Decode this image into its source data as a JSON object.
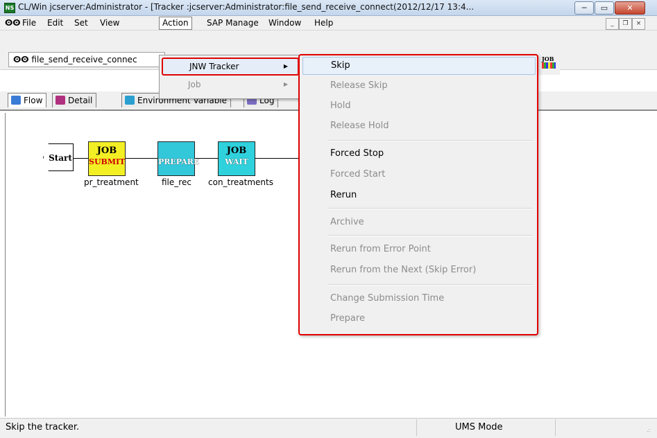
{
  "window": {
    "app_icon_text": "NS",
    "title": "CL/Win jcserver:Administrator - [Tracker :jcserver:Administrator:file_send_receive_connect(2012/12/17 13:4...",
    "controls": {
      "minimize": "─",
      "maximize": "▭",
      "close": "✕"
    }
  },
  "menubar": {
    "doc_icon": "ⵙⵙ",
    "items": [
      "File",
      "Edit",
      "Set",
      "View",
      "Action",
      "SAP Manage",
      "Window",
      "Help"
    ],
    "mdi_controls": {
      "minimize": "_",
      "restore": "❐",
      "close": "×"
    }
  },
  "toolbar": {
    "jobnet_name": "file_send_receive_connec",
    "logo_text": "JOB"
  },
  "tabs": [
    {
      "label": "Flow",
      "icon": "flow-icon",
      "color": "#3a7bd5"
    },
    {
      "label": "Detail",
      "icon": "detail-icon",
      "color": "#b03080"
    },
    {
      "label": "Environment Variable",
      "icon": "environment-icon",
      "color": "#2a9fd0"
    },
    {
      "label": "Log",
      "icon": "log-icon",
      "color": "#7a6cc0"
    }
  ],
  "flow": {
    "nodes": [
      {
        "id": "start",
        "text": "Start"
      },
      {
        "id": "submit",
        "line1": "JOB",
        "line2": "SUBMIT",
        "label": "pr_treatment"
      },
      {
        "id": "prepare",
        "line1": "",
        "line2": "PREPARE",
        "label": "file_rec"
      },
      {
        "id": "wait",
        "line1": "JOB",
        "line2": "WAIT",
        "label": "con_treatments"
      }
    ]
  },
  "action_menu": {
    "items": [
      {
        "label": "JNW Tracker",
        "has_submenu": true,
        "enabled": true,
        "highlighted": true
      },
      {
        "label": "Job",
        "has_submenu": true,
        "enabled": false
      }
    ]
  },
  "jnw_tracker_submenu": {
    "items": [
      {
        "label": "Skip",
        "enabled": true,
        "highlighted": true
      },
      {
        "label": "Release Skip",
        "enabled": false
      },
      {
        "label": "Hold",
        "enabled": false
      },
      {
        "label": "Release Hold",
        "enabled": false
      },
      {
        "label": "Forced Stop",
        "enabled": true
      },
      {
        "label": "Forced Start",
        "enabled": false
      },
      {
        "label": "Rerun",
        "enabled": true
      },
      {
        "label": "Archive",
        "enabled": false
      },
      {
        "label": "Rerun from Error Point",
        "enabled": false
      },
      {
        "label": "Rerun from the Next (Skip Error)",
        "enabled": false
      },
      {
        "label": "Change Submission Time",
        "enabled": false
      },
      {
        "label": "Prepare",
        "enabled": false
      }
    ]
  },
  "statusbar": {
    "message": "Skip the tracker.",
    "mode": "UMS Mode",
    "grip": ".:"
  },
  "colors": {
    "highlight_border": "#e00000",
    "job_submit": "#f3ef25",
    "job_wait": "#2fd1dd",
    "prepare": "#33c7da"
  }
}
